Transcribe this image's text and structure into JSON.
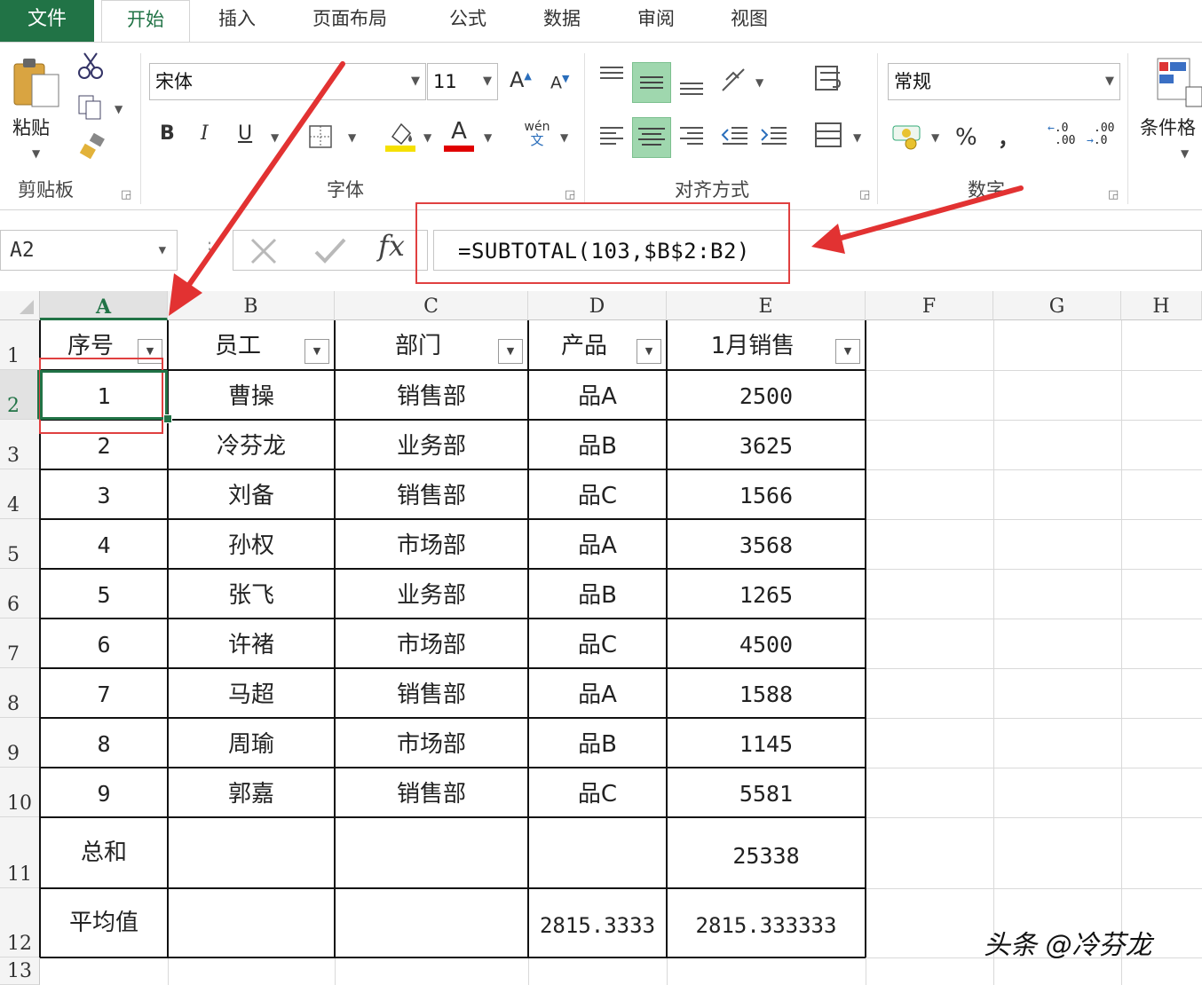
{
  "tabs": {
    "file": "文件",
    "home": "开始",
    "insert": "插入",
    "layout": "页面布局",
    "formulas": "公式",
    "data": "数据",
    "review": "审阅",
    "view": "视图"
  },
  "ribbon": {
    "clipboard": {
      "label": "剪贴板",
      "paste": "粘贴"
    },
    "font": {
      "label": "字体",
      "name": "宋体",
      "size": "11",
      "bold": "B",
      "italic": "I",
      "underline": "U",
      "grow": "A",
      "shrink": "A",
      "phonetic_top": "wén",
      "phonetic_bottom": "文"
    },
    "alignment": {
      "label": "对齐方式"
    },
    "number": {
      "label": "数字",
      "format": "常规",
      "percent": "%",
      "comma": "，",
      "inc_decimal_a": ".0",
      "inc_decimal_b": ".00",
      "dec_decimal_a": ".00",
      "dec_decimal_b": ".0"
    },
    "styles": {
      "conditional": "条件格"
    }
  },
  "formula_bar": {
    "name_box": "A2",
    "formula": "=SUBTOTAL(103,$B$2:B2)",
    "fx": "fx"
  },
  "columns": [
    "A",
    "B",
    "C",
    "D",
    "E",
    "F",
    "G",
    "H"
  ],
  "rows": [
    "1",
    "2",
    "3",
    "4",
    "5",
    "6",
    "7",
    "8",
    "9",
    "10",
    "11",
    "12",
    "13"
  ],
  "table": {
    "headers": [
      "序号",
      "员工",
      "部门",
      "产品",
      "1月销售"
    ],
    "data": [
      [
        "1",
        "曹操",
        "销售部",
        "品A",
        "2500"
      ],
      [
        "2",
        "冷芬龙",
        "业务部",
        "品B",
        "3625"
      ],
      [
        "3",
        "刘备",
        "销售部",
        "品C",
        "1566"
      ],
      [
        "4",
        "孙权",
        "市场部",
        "品A",
        "3568"
      ],
      [
        "5",
        "张飞",
        "业务部",
        "品B",
        "1265"
      ],
      [
        "6",
        "许褚",
        "市场部",
        "品C",
        "4500"
      ],
      [
        "7",
        "马超",
        "销售部",
        "品A",
        "1588"
      ],
      [
        "8",
        "周瑜",
        "市场部",
        "品B",
        "1145"
      ],
      [
        "9",
        "郭嘉",
        "销售部",
        "品C",
        "5581"
      ]
    ],
    "sum_label": "总和",
    "sum_value": "25338",
    "avg_label": "平均值",
    "avg_d": "2815.3333",
    "avg_e": "2815.333333"
  },
  "watermark": "头条 @冷芬龙",
  "colors": {
    "excel_green": "#217346",
    "annotation_red": "#e04040",
    "highlight": "#9fd7ae"
  }
}
